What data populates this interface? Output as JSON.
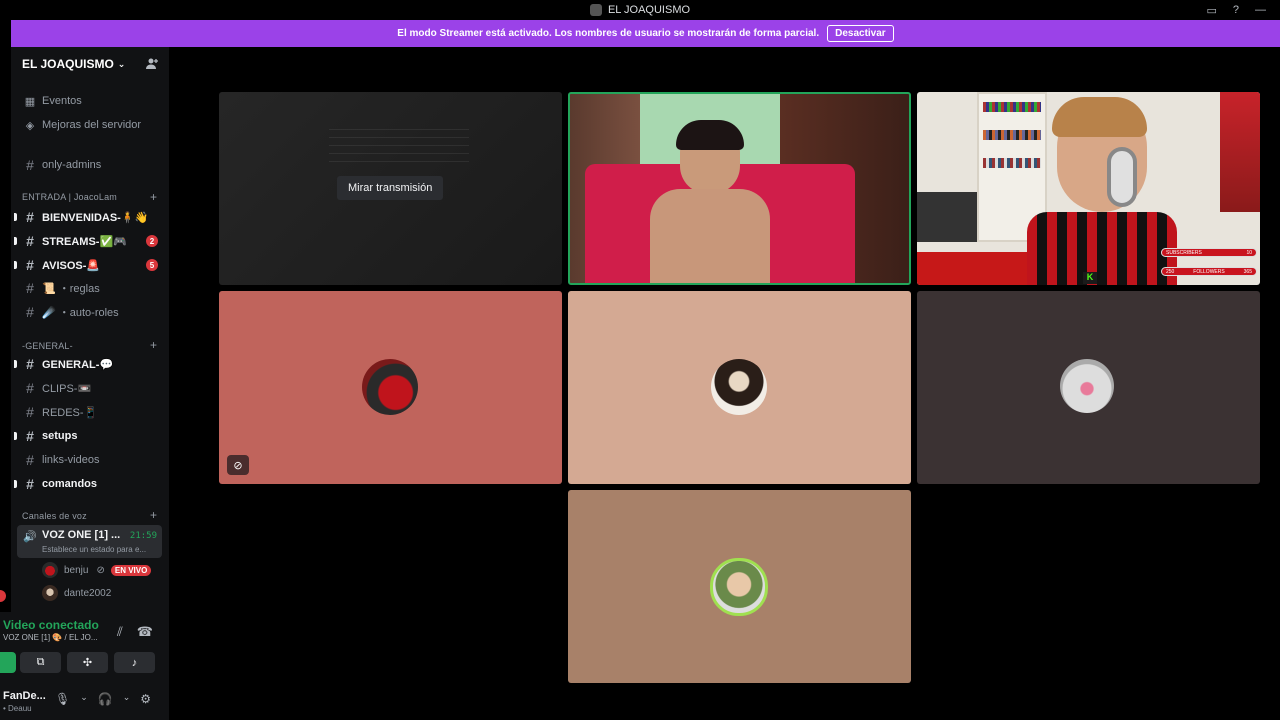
{
  "window": {
    "title": "EL JOAQUISMO"
  },
  "streamer_banner": {
    "text": "El modo Streamer está activado. Los nombres de usuario se mostrarán de forma parcial.",
    "button": "Desactivar"
  },
  "server": {
    "name": "EL JOAQUISMO"
  },
  "sidebar": {
    "top_items": [
      {
        "label": "Eventos",
        "icon": "calendar-icon"
      },
      {
        "label": "Mejoras del servidor",
        "icon": "boost-icon"
      }
    ],
    "only_admins": "only-admins",
    "category_entrada": "ENTRADA | JoacoLam",
    "entrada_channels": [
      {
        "label": "BIENVENIDAS-🧍👋",
        "bold": true,
        "badge": ""
      },
      {
        "label": "STREAMS-✅🎮",
        "bold": true,
        "badge": "2"
      },
      {
        "label": "AVISOS-🚨",
        "bold": true,
        "badge": "5"
      },
      {
        "label": "📜 ・reglas",
        "bold": false,
        "badge": ""
      },
      {
        "label": "☄️ ・auto-roles",
        "bold": false,
        "badge": ""
      }
    ],
    "category_general": "-GENERAL-",
    "general_channels": [
      {
        "label": "GENERAL-💬",
        "bold": true
      },
      {
        "label": "CLIPS-📼",
        "bold": false
      },
      {
        "label": "REDES-📱",
        "bold": false
      },
      {
        "label": "setups",
        "bold": true
      },
      {
        "label": "links-videos",
        "bold": false
      },
      {
        "label": "comandos",
        "bold": true
      }
    ],
    "category_voice": "Canales de voz",
    "voice_channel": {
      "name": "VOZ ONE [1] ...",
      "time": "21:59",
      "status": "Establece un estado para e..."
    },
    "voice_users": [
      {
        "name": "benju",
        "live": "EN VIVO"
      },
      {
        "name": "dante2002",
        "live": ""
      }
    ]
  },
  "panel": {
    "title": "Video conectado",
    "subtitle": "VOZ ONE [1] 🎨 / EL JO...",
    "user_name": "FanDe...",
    "user_status": "• Deauu"
  },
  "tiles": {
    "watch_button": "Mirar transmisión",
    "stream_overlay": {
      "row1_label": "SUBSCRIBERS",
      "row1_value": "10",
      "row2_prefix": "250",
      "row2_label": "FOLLOWERS",
      "row2_value": "365"
    }
  },
  "colors": {
    "streamer_bar": "#9b42e8",
    "connected_green": "#23a55a",
    "tile_red": "#c0645c",
    "tile_beige": "#d4a993",
    "tile_dark": "#3b3233",
    "tile_brown": "#a88169"
  }
}
